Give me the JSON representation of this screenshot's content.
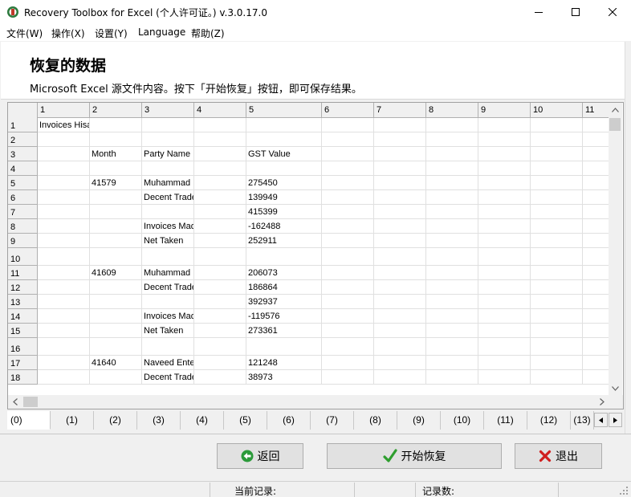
{
  "window": {
    "title": "Recovery Toolbox for Excel (个人许可证。) v.3.0.17.0"
  },
  "menu": {
    "items": [
      "文件(W)",
      "操作(X)",
      "设置(Y)",
      "Language",
      "帮助(Z)"
    ]
  },
  "header": {
    "title": "恢复的数据",
    "subtitle": "Microsoft Excel 源文件内容。按下「开始恢复」按钮，即可保存结果。"
  },
  "grid": {
    "columns": [
      "1",
      "2",
      "3",
      "4",
      "5",
      "6",
      "7",
      "8",
      "9",
      "10",
      "11"
    ],
    "rows": [
      {
        "num": "1",
        "cells": [
          "Invoices Hisa",
          "",
          "",
          "",
          "",
          "",
          "",
          "",
          "",
          "",
          ""
        ]
      },
      {
        "num": "2",
        "cells": [
          "",
          "",
          "",
          "",
          "",
          "",
          "",
          "",
          "",
          "",
          ""
        ]
      },
      {
        "num": "3",
        "cells": [
          "",
          "Month",
          "Party Name",
          "",
          "GST Value",
          "",
          "",
          "",
          "",
          "",
          ""
        ]
      },
      {
        "num": "4",
        "cells": [
          "",
          "",
          "",
          "",
          "",
          "",
          "",
          "",
          "",
          "",
          ""
        ]
      },
      {
        "num": "5",
        "cells": [
          "",
          "41579",
          "Muhammad H",
          "",
          "275450",
          "",
          "",
          "",
          "",
          "",
          ""
        ]
      },
      {
        "num": "6",
        "cells": [
          "",
          "",
          "Decent Trade",
          "",
          "139949",
          "",
          "",
          "",
          "",
          "",
          ""
        ]
      },
      {
        "num": "7",
        "cells": [
          "",
          "",
          "",
          "",
          "415399",
          "",
          "",
          "",
          "",
          "",
          ""
        ]
      },
      {
        "num": "8",
        "cells": [
          "",
          "",
          "Invoices Mad",
          "",
          "-162488",
          "",
          "",
          "",
          "",
          "",
          ""
        ]
      },
      {
        "num": "9",
        "cells": [
          "",
          "",
          "Net Taken",
          "",
          "252911",
          "",
          "",
          "",
          "",
          "",
          ""
        ]
      },
      {
        "num": "10",
        "cells": [
          "",
          "",
          "",
          "",
          "",
          "",
          "",
          "",
          "",
          "",
          ""
        ]
      },
      {
        "num": "11",
        "cells": [
          "",
          "41609",
          "Muhammad H",
          "",
          "206073",
          "",
          "",
          "",
          "",
          "",
          ""
        ]
      },
      {
        "num": "12",
        "cells": [
          "",
          "",
          "Decent Trade",
          "",
          "186864",
          "",
          "",
          "",
          "",
          "",
          ""
        ]
      },
      {
        "num": "13",
        "cells": [
          "",
          "",
          "",
          "",
          "392937",
          "",
          "",
          "",
          "",
          "",
          ""
        ]
      },
      {
        "num": "14",
        "cells": [
          "",
          "",
          "Invoices Mad",
          "",
          "-119576",
          "",
          "",
          "",
          "",
          "",
          ""
        ]
      },
      {
        "num": "15",
        "cells": [
          "",
          "",
          "Net Taken",
          "",
          "273361",
          "",
          "",
          "",
          "",
          "",
          ""
        ]
      },
      {
        "num": "16",
        "cells": [
          "",
          "",
          "",
          "",
          "",
          "",
          "",
          "",
          "",
          "",
          ""
        ]
      },
      {
        "num": "17",
        "cells": [
          "",
          "41640",
          "Naveed Enter",
          "",
          "121248",
          "",
          "",
          "",
          "",
          "",
          ""
        ]
      },
      {
        "num": "18",
        "cells": [
          "",
          "",
          "Decent Trade",
          "",
          "38973",
          "",
          "",
          "",
          "",
          "",
          ""
        ]
      }
    ]
  },
  "sheet_tabs": [
    "(0)",
    "(1)",
    "(2)",
    "(3)",
    "(4)",
    "(5)",
    "(6)",
    "(7)",
    "(8)",
    "(9)",
    "(10)",
    "(11)",
    "(12)",
    "(13)"
  ],
  "buttons": {
    "back": "返回",
    "start": "开始恢复",
    "exit": "退出"
  },
  "status": {
    "current_record": "当前记录:",
    "record_count": "记录数:"
  },
  "colors": {
    "start_check": "#2e9e2e",
    "back_icon": "#2b9a3a",
    "exit_icon": "#d01e1e"
  }
}
